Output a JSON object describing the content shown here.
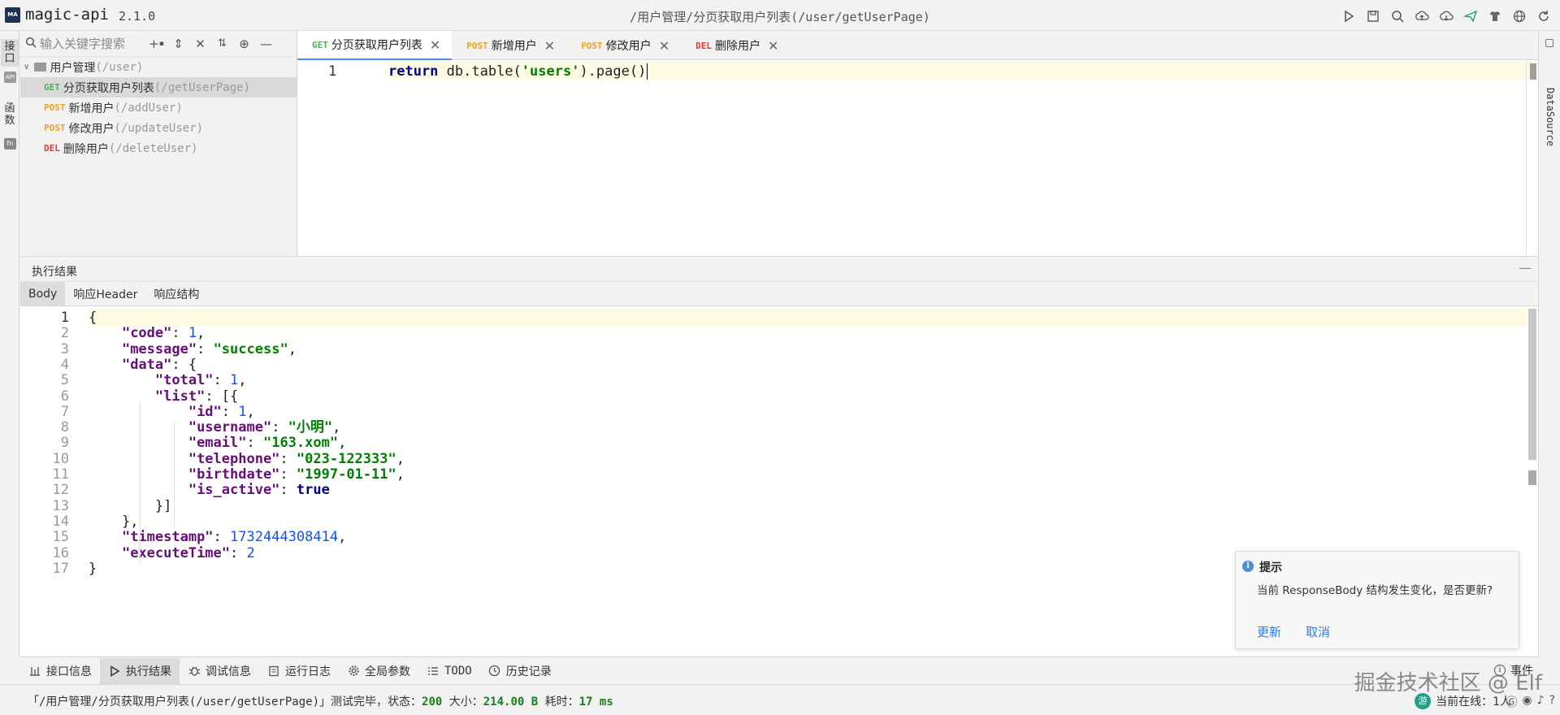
{
  "app": {
    "logo": "MA",
    "name": "magic-api",
    "version": "2.1.0"
  },
  "window_title": "/用户管理/分页获取用户列表(/user/getUserPage)",
  "left_strip": {
    "tab1": "接口",
    "tab2": "函数",
    "badge2": "fn"
  },
  "right_strip": {
    "datasource": "DataSource"
  },
  "sidebar": {
    "search_placeholder": "输入关键字搜索",
    "group": {
      "label": "用户管理",
      "path": "(/user)"
    },
    "items": [
      {
        "method": "GET",
        "label": "分页获取用户列表",
        "path": "(/getUserPage)"
      },
      {
        "method": "POST",
        "label": "新增用户",
        "path": "(/addUser)"
      },
      {
        "method": "POST",
        "label": "修改用户",
        "path": "(/updateUser)"
      },
      {
        "method": "DEL",
        "label": "删除用户",
        "path": "(/deleteUser)"
      }
    ]
  },
  "tabs": [
    {
      "method": "GET",
      "label": "分页获取用户列表"
    },
    {
      "method": "POST",
      "label": "新增用户"
    },
    {
      "method": "POST",
      "label": "修改用户"
    },
    {
      "method": "DEL",
      "label": "删除用户"
    }
  ],
  "editor": {
    "line_number": "1",
    "keyword": "return",
    "code_pre": " db.table(",
    "code_str": "'users'",
    "code_post": ").page()"
  },
  "result": {
    "title": "执行结果",
    "tabs": [
      "Body",
      "响应Header",
      "响应结构"
    ],
    "lines": [
      {
        "n": "1",
        "indent": "",
        "parts": [
          [
            "p",
            "{"
          ]
        ]
      },
      {
        "n": "2",
        "indent": "    ",
        "parts": [
          [
            "k",
            "\"code\""
          ],
          [
            "p",
            ": "
          ],
          [
            "n",
            "1"
          ],
          [
            "p",
            ","
          ]
        ]
      },
      {
        "n": "3",
        "indent": "    ",
        "parts": [
          [
            "k",
            "\"message\""
          ],
          [
            "p",
            ": "
          ],
          [
            "s",
            "\"success\""
          ],
          [
            "p",
            ","
          ]
        ]
      },
      {
        "n": "4",
        "indent": "    ",
        "parts": [
          [
            "k",
            "\"data\""
          ],
          [
            "p",
            ": {"
          ]
        ]
      },
      {
        "n": "5",
        "indent": "        ",
        "parts": [
          [
            "k",
            "\"total\""
          ],
          [
            "p",
            ": "
          ],
          [
            "n",
            "1"
          ],
          [
            "p",
            ","
          ]
        ]
      },
      {
        "n": "6",
        "indent": "        ",
        "parts": [
          [
            "k",
            "\"list\""
          ],
          [
            "p",
            ": [{"
          ]
        ]
      },
      {
        "n": "7",
        "indent": "            ",
        "parts": [
          [
            "k",
            "\"id\""
          ],
          [
            "p",
            ": "
          ],
          [
            "n",
            "1"
          ],
          [
            "p",
            ","
          ]
        ]
      },
      {
        "n": "8",
        "indent": "            ",
        "parts": [
          [
            "k",
            "\"username\""
          ],
          [
            "p",
            ": "
          ],
          [
            "s",
            "\"小明\""
          ],
          [
            "p",
            ","
          ]
        ]
      },
      {
        "n": "9",
        "indent": "            ",
        "parts": [
          [
            "k",
            "\"email\""
          ],
          [
            "p",
            ": "
          ],
          [
            "s",
            "\"163.xom\""
          ],
          [
            "p",
            ","
          ]
        ]
      },
      {
        "n": "10",
        "indent": "            ",
        "parts": [
          [
            "k",
            "\"telephone\""
          ],
          [
            "p",
            ": "
          ],
          [
            "s",
            "\"023-122333\""
          ],
          [
            "p",
            ","
          ]
        ]
      },
      {
        "n": "11",
        "indent": "            ",
        "parts": [
          [
            "k",
            "\"birthdate\""
          ],
          [
            "p",
            ": "
          ],
          [
            "s",
            "\"1997-01-11\""
          ],
          [
            "p",
            ","
          ]
        ]
      },
      {
        "n": "12",
        "indent": "            ",
        "parts": [
          [
            "k",
            "\"is_active\""
          ],
          [
            "p",
            ": "
          ],
          [
            "b",
            "true"
          ]
        ]
      },
      {
        "n": "13",
        "indent": "        ",
        "parts": [
          [
            "p",
            "}]"
          ]
        ]
      },
      {
        "n": "14",
        "indent": "    ",
        "parts": [
          [
            "p",
            "},"
          ]
        ]
      },
      {
        "n": "15",
        "indent": "    ",
        "parts": [
          [
            "k",
            "\"timestamp\""
          ],
          [
            "p",
            ": "
          ],
          [
            "n",
            "1732444308414"
          ],
          [
            "p",
            ","
          ]
        ]
      },
      {
        "n": "16",
        "indent": "    ",
        "parts": [
          [
            "k",
            "\"executeTime\""
          ],
          [
            "p",
            ": "
          ],
          [
            "n",
            "2"
          ]
        ]
      },
      {
        "n": "17",
        "indent": "",
        "parts": [
          [
            "p",
            "}"
          ]
        ]
      }
    ]
  },
  "notification": {
    "title": "提示",
    "message": "当前 ResponseBody 结构发生变化，是否更新?",
    "update": "更新",
    "cancel": "取消"
  },
  "bottom_tools": [
    {
      "icon": "info-icon",
      "label": "接口信息"
    },
    {
      "icon": "play-icon",
      "label": "执行结果"
    },
    {
      "icon": "bug-icon",
      "label": "调试信息"
    },
    {
      "icon": "log-icon",
      "label": "运行日志"
    },
    {
      "icon": "gear-icon",
      "label": "全局参数"
    },
    {
      "icon": "list-icon",
      "label": "TODO"
    },
    {
      "icon": "clock-icon",
      "label": "历史记录"
    }
  ],
  "events_label": "事件",
  "status": {
    "prefix": "「/用户管理/分页获取用户列表(/user/getUserPage)」测试完毕，状态：",
    "state": "200",
    "size_label": " 大小：",
    "size": "214.00 B",
    "time_label": " 耗时：",
    "time": "17 ms",
    "online_badge": "游",
    "online": "当前在线：1人"
  },
  "watermark": "掘金技术社区 @ Elf",
  "colors": {
    "get": "#4caf50",
    "post": "#f0a020",
    "del": "#e53935",
    "accent": "#4a90e2",
    "link": "#2d7ee8"
  }
}
